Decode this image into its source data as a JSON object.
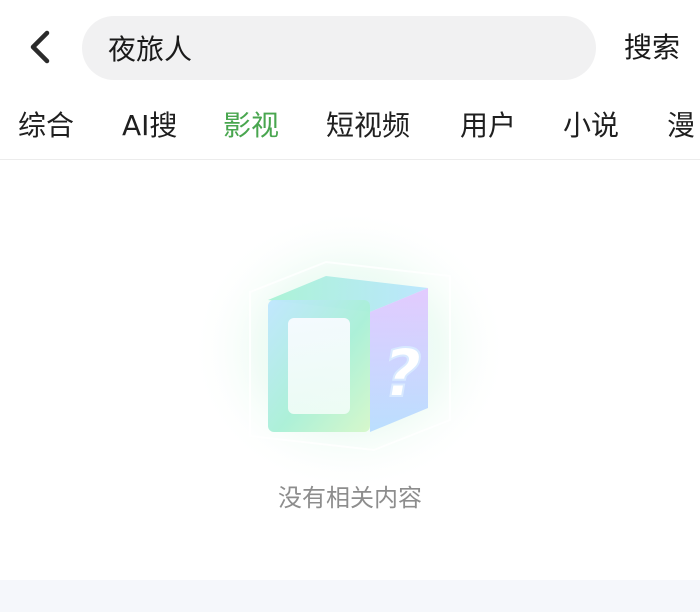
{
  "search": {
    "value": "夜旅人",
    "button_label": "搜索"
  },
  "tabs": [
    {
      "label": "综合"
    },
    {
      "label": "AI搜"
    },
    {
      "label": "影视"
    },
    {
      "label": "短视频"
    },
    {
      "label": "用户"
    },
    {
      "label": "小说"
    },
    {
      "label": "漫"
    }
  ],
  "active_tab": "影视",
  "empty_state": {
    "message": "没有相关内容",
    "illustration": "question-box-icon"
  },
  "colors": {
    "accent": "#49a64f",
    "search_bg": "#f1f1f2",
    "muted_text": "#8d8d8d"
  },
  "icons": {
    "back": "chevron-left-icon"
  }
}
